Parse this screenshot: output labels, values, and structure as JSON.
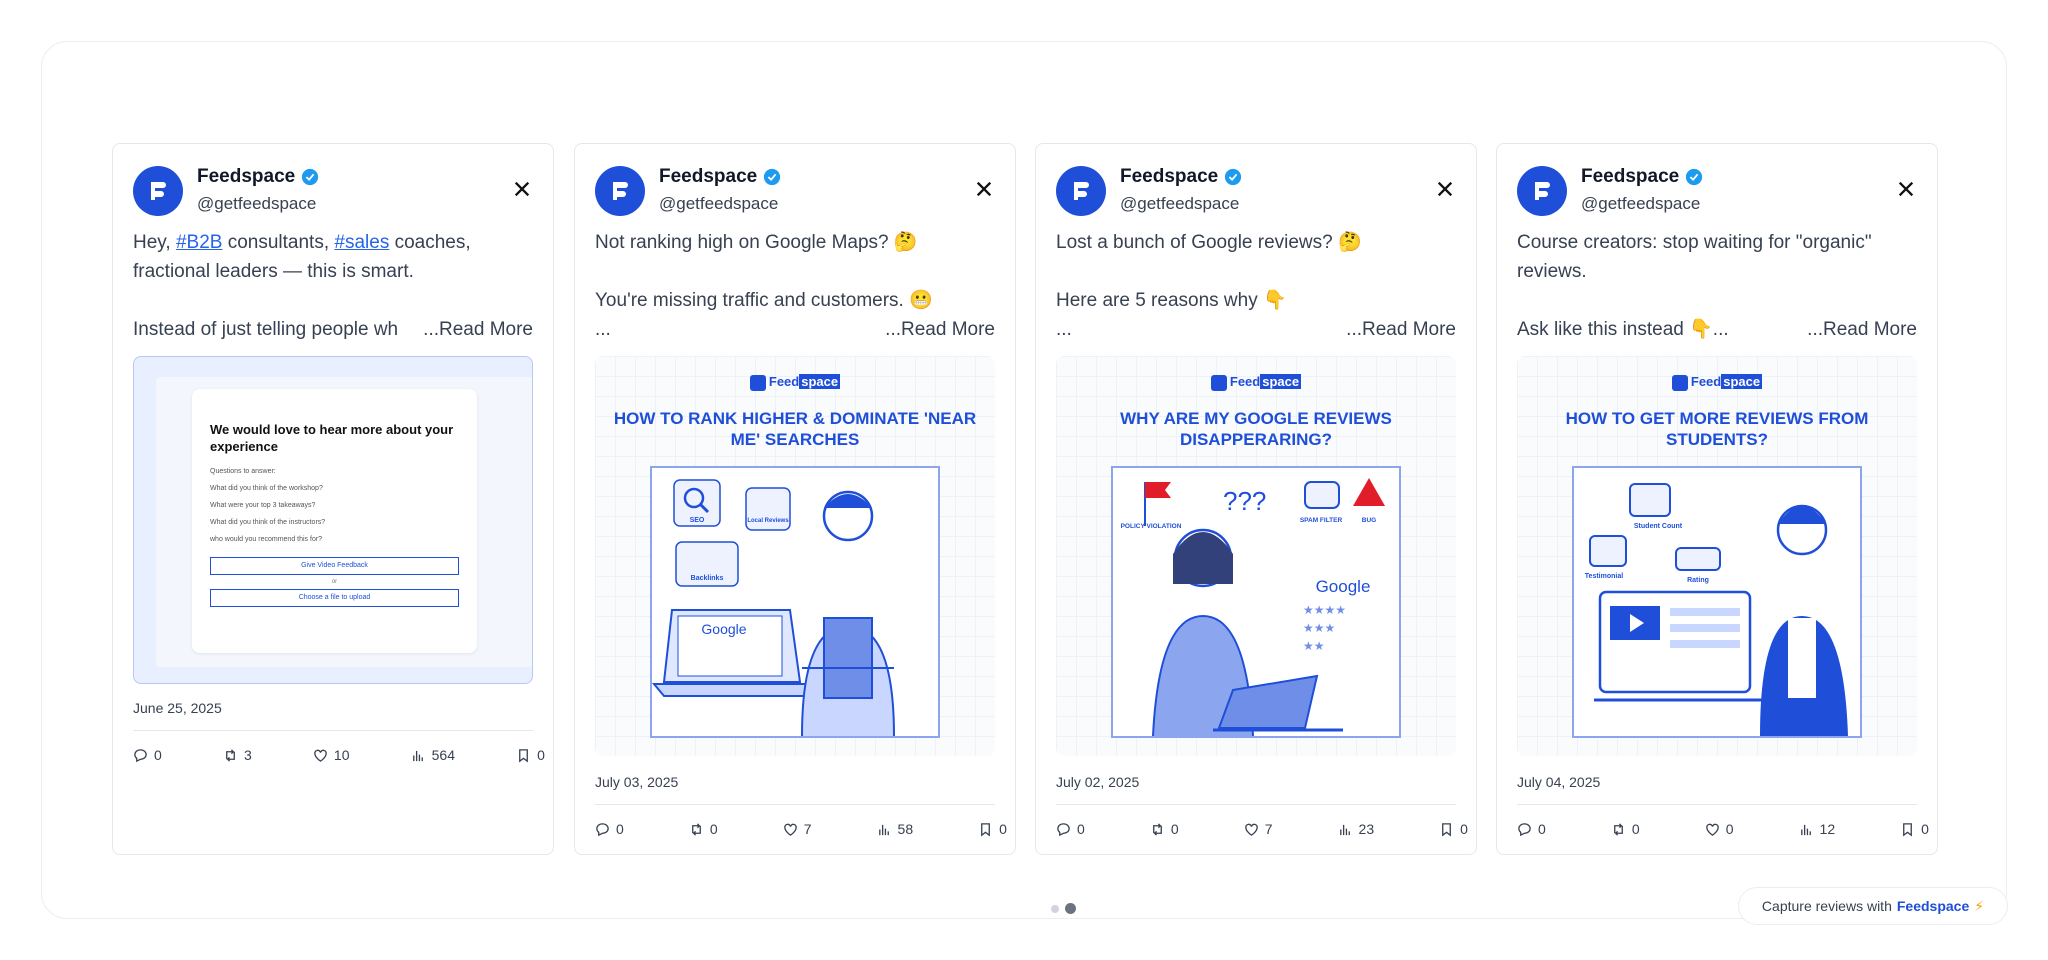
{
  "cards": [
    {
      "name": "Feedspace",
      "handle": "@getfeedspace",
      "body_lines": [
        "Hey, ",
        "#B2B",
        " consultants, ",
        "#sales",
        " coaches,",
        "fractional leaders — this is smart.",
        "",
        "Instead of just telling people wh",
        "...Read More"
      ],
      "date": "June 25, 2025",
      "stats": {
        "replies": "0",
        "retweets": "3",
        "likes": "10",
        "views": "564",
        "bookmarks": "0"
      },
      "form": {
        "title": "We would love to hear more about your experience",
        "questions_label": "Questions to answer:",
        "q1": "What did you think of the workshop?",
        "q2": "What were your top 3 takeaways?",
        "q3": "What did you think of the instructors?",
        "q4": "who would you recommend this for?",
        "video_btn": "Give Video Feedback",
        "or": "or",
        "file_btn": "Choose a file to upload"
      }
    },
    {
      "name": "Feedspace",
      "handle": "@getfeedspace",
      "line1": "Not ranking high on Google Maps? 🤔",
      "line3": "You're missing traffic and customers. 😬",
      "line4": "...",
      "readmore": "...Read More",
      "date": "July 03, 2025",
      "stats": {
        "replies": "0",
        "retweets": "0",
        "likes": "7",
        "views": "58",
        "bookmarks": "0"
      },
      "info": {
        "brand": "Feed",
        "brand2": "space",
        "title": "HOW TO RANK HIGHER & DOMINATE 'NEAR ME' SEARCHES",
        "l1": "SEO",
        "l2": "Local Reviews",
        "l3": "Backlinks",
        "g": "Google"
      }
    },
    {
      "name": "Feedspace",
      "handle": "@getfeedspace",
      "line1": "Lost a bunch of Google reviews? 🤔",
      "line3": "Here are 5 reasons why 👇",
      "line4": "...",
      "readmore": "...Read More",
      "date": "July 02, 2025",
      "stats": {
        "replies": "0",
        "retweets": "0",
        "likes": "7",
        "views": "23",
        "bookmarks": "0"
      },
      "info": {
        "brand": "Feed",
        "brand2": "space",
        "title": "WHY ARE MY GOOGLE REVIEWS DISAPPERARING?",
        "l1": "POLICY VIOLATION",
        "l2": "SPAM FILTER",
        "l3": "BUG",
        "g": "Google"
      }
    },
    {
      "name": "Feedspace",
      "handle": "@getfeedspace",
      "line1": "Course creators: stop waiting for \"organic\"",
      "line2": "reviews.",
      "line3": "Ask like this instead 👇...",
      "readmore": "...Read More",
      "date": "July 04, 2025",
      "stats": {
        "replies": "0",
        "retweets": "0",
        "likes": "0",
        "views": "12",
        "bookmarks": "0"
      },
      "info": {
        "brand": "Feed",
        "brand2": "space",
        "title": "HOW TO GET MORE REVIEWS FROM STUDENTS?",
        "l1": "Student Count",
        "l2": "Testimonial",
        "l3": "Rating"
      }
    }
  ],
  "footer": {
    "capture_prefix": "Capture reviews with",
    "capture_brand": "Feedspace",
    "bolt": "⚡"
  },
  "colors": {
    "brand": "#1f4fd9",
    "verified": "#1d9bf0",
    "link": "#2563eb"
  }
}
